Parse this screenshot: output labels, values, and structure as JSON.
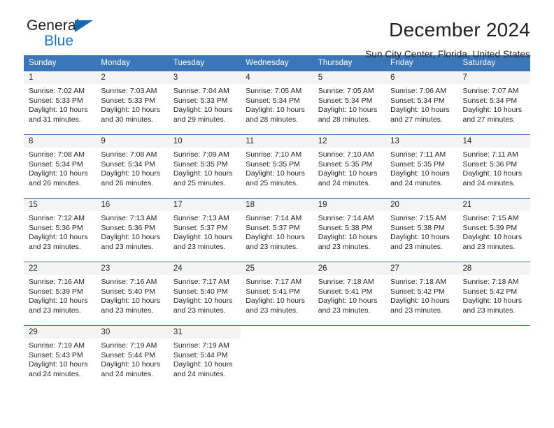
{
  "logo": {
    "text_top": "General",
    "text_bottom": "Blue"
  },
  "header": {
    "title": "December 2024",
    "subtitle": "Sun City Center, Florida, United States"
  },
  "colors": {
    "header_blue": "#3b77b8",
    "logo_blue": "#1e73be",
    "daynum_bg": "#f4f4f4",
    "text": "#231f20"
  },
  "weekday_headers": [
    "Sunday",
    "Monday",
    "Tuesday",
    "Wednesday",
    "Thursday",
    "Friday",
    "Saturday"
  ],
  "weeks": [
    [
      {
        "day": "1",
        "sunrise": "Sunrise: 7:02 AM",
        "sunset": "Sunset: 5:33 PM",
        "daylight_1": "Daylight: 10 hours",
        "daylight_2": "and 31 minutes."
      },
      {
        "day": "2",
        "sunrise": "Sunrise: 7:03 AM",
        "sunset": "Sunset: 5:33 PM",
        "daylight_1": "Daylight: 10 hours",
        "daylight_2": "and 30 minutes."
      },
      {
        "day": "3",
        "sunrise": "Sunrise: 7:04 AM",
        "sunset": "Sunset: 5:33 PM",
        "daylight_1": "Daylight: 10 hours",
        "daylight_2": "and 29 minutes."
      },
      {
        "day": "4",
        "sunrise": "Sunrise: 7:05 AM",
        "sunset": "Sunset: 5:34 PM",
        "daylight_1": "Daylight: 10 hours",
        "daylight_2": "and 28 minutes."
      },
      {
        "day": "5",
        "sunrise": "Sunrise: 7:05 AM",
        "sunset": "Sunset: 5:34 PM",
        "daylight_1": "Daylight: 10 hours",
        "daylight_2": "and 28 minutes."
      },
      {
        "day": "6",
        "sunrise": "Sunrise: 7:06 AM",
        "sunset": "Sunset: 5:34 PM",
        "daylight_1": "Daylight: 10 hours",
        "daylight_2": "and 27 minutes."
      },
      {
        "day": "7",
        "sunrise": "Sunrise: 7:07 AM",
        "sunset": "Sunset: 5:34 PM",
        "daylight_1": "Daylight: 10 hours",
        "daylight_2": "and 27 minutes."
      }
    ],
    [
      {
        "day": "8",
        "sunrise": "Sunrise: 7:08 AM",
        "sunset": "Sunset: 5:34 PM",
        "daylight_1": "Daylight: 10 hours",
        "daylight_2": "and 26 minutes."
      },
      {
        "day": "9",
        "sunrise": "Sunrise: 7:08 AM",
        "sunset": "Sunset: 5:34 PM",
        "daylight_1": "Daylight: 10 hours",
        "daylight_2": "and 26 minutes."
      },
      {
        "day": "10",
        "sunrise": "Sunrise: 7:09 AM",
        "sunset": "Sunset: 5:35 PM",
        "daylight_1": "Daylight: 10 hours",
        "daylight_2": "and 25 minutes."
      },
      {
        "day": "11",
        "sunrise": "Sunrise: 7:10 AM",
        "sunset": "Sunset: 5:35 PM",
        "daylight_1": "Daylight: 10 hours",
        "daylight_2": "and 25 minutes."
      },
      {
        "day": "12",
        "sunrise": "Sunrise: 7:10 AM",
        "sunset": "Sunset: 5:35 PM",
        "daylight_1": "Daylight: 10 hours",
        "daylight_2": "and 24 minutes."
      },
      {
        "day": "13",
        "sunrise": "Sunrise: 7:11 AM",
        "sunset": "Sunset: 5:35 PM",
        "daylight_1": "Daylight: 10 hours",
        "daylight_2": "and 24 minutes."
      },
      {
        "day": "14",
        "sunrise": "Sunrise: 7:11 AM",
        "sunset": "Sunset: 5:36 PM",
        "daylight_1": "Daylight: 10 hours",
        "daylight_2": "and 24 minutes."
      }
    ],
    [
      {
        "day": "15",
        "sunrise": "Sunrise: 7:12 AM",
        "sunset": "Sunset: 5:36 PM",
        "daylight_1": "Daylight: 10 hours",
        "daylight_2": "and 23 minutes."
      },
      {
        "day": "16",
        "sunrise": "Sunrise: 7:13 AM",
        "sunset": "Sunset: 5:36 PM",
        "daylight_1": "Daylight: 10 hours",
        "daylight_2": "and 23 minutes."
      },
      {
        "day": "17",
        "sunrise": "Sunrise: 7:13 AM",
        "sunset": "Sunset: 5:37 PM",
        "daylight_1": "Daylight: 10 hours",
        "daylight_2": "and 23 minutes."
      },
      {
        "day": "18",
        "sunrise": "Sunrise: 7:14 AM",
        "sunset": "Sunset: 5:37 PM",
        "daylight_1": "Daylight: 10 hours",
        "daylight_2": "and 23 minutes."
      },
      {
        "day": "19",
        "sunrise": "Sunrise: 7:14 AM",
        "sunset": "Sunset: 5:38 PM",
        "daylight_1": "Daylight: 10 hours",
        "daylight_2": "and 23 minutes."
      },
      {
        "day": "20",
        "sunrise": "Sunrise: 7:15 AM",
        "sunset": "Sunset: 5:38 PM",
        "daylight_1": "Daylight: 10 hours",
        "daylight_2": "and 23 minutes."
      },
      {
        "day": "21",
        "sunrise": "Sunrise: 7:15 AM",
        "sunset": "Sunset: 5:39 PM",
        "daylight_1": "Daylight: 10 hours",
        "daylight_2": "and 23 minutes."
      }
    ],
    [
      {
        "day": "22",
        "sunrise": "Sunrise: 7:16 AM",
        "sunset": "Sunset: 5:39 PM",
        "daylight_1": "Daylight: 10 hours",
        "daylight_2": "and 23 minutes."
      },
      {
        "day": "23",
        "sunrise": "Sunrise: 7:16 AM",
        "sunset": "Sunset: 5:40 PM",
        "daylight_1": "Daylight: 10 hours",
        "daylight_2": "and 23 minutes."
      },
      {
        "day": "24",
        "sunrise": "Sunrise: 7:17 AM",
        "sunset": "Sunset: 5:40 PM",
        "daylight_1": "Daylight: 10 hours",
        "daylight_2": "and 23 minutes."
      },
      {
        "day": "25",
        "sunrise": "Sunrise: 7:17 AM",
        "sunset": "Sunset: 5:41 PM",
        "daylight_1": "Daylight: 10 hours",
        "daylight_2": "and 23 minutes."
      },
      {
        "day": "26",
        "sunrise": "Sunrise: 7:18 AM",
        "sunset": "Sunset: 5:41 PM",
        "daylight_1": "Daylight: 10 hours",
        "daylight_2": "and 23 minutes."
      },
      {
        "day": "27",
        "sunrise": "Sunrise: 7:18 AM",
        "sunset": "Sunset: 5:42 PM",
        "daylight_1": "Daylight: 10 hours",
        "daylight_2": "and 23 minutes."
      },
      {
        "day": "28",
        "sunrise": "Sunrise: 7:18 AM",
        "sunset": "Sunset: 5:42 PM",
        "daylight_1": "Daylight: 10 hours",
        "daylight_2": "and 23 minutes."
      }
    ],
    [
      {
        "day": "29",
        "sunrise": "Sunrise: 7:19 AM",
        "sunset": "Sunset: 5:43 PM",
        "daylight_1": "Daylight: 10 hours",
        "daylight_2": "and 24 minutes."
      },
      {
        "day": "30",
        "sunrise": "Sunrise: 7:19 AM",
        "sunset": "Sunset: 5:44 PM",
        "daylight_1": "Daylight: 10 hours",
        "daylight_2": "and 24 minutes."
      },
      {
        "day": "31",
        "sunrise": "Sunrise: 7:19 AM",
        "sunset": "Sunset: 5:44 PM",
        "daylight_1": "Daylight: 10 hours",
        "daylight_2": "and 24 minutes."
      },
      {
        "day": "",
        "sunrise": "",
        "sunset": "",
        "daylight_1": "",
        "daylight_2": ""
      },
      {
        "day": "",
        "sunrise": "",
        "sunset": "",
        "daylight_1": "",
        "daylight_2": ""
      },
      {
        "day": "",
        "sunrise": "",
        "sunset": "",
        "daylight_1": "",
        "daylight_2": ""
      },
      {
        "day": "",
        "sunrise": "",
        "sunset": "",
        "daylight_1": "",
        "daylight_2": ""
      }
    ]
  ]
}
